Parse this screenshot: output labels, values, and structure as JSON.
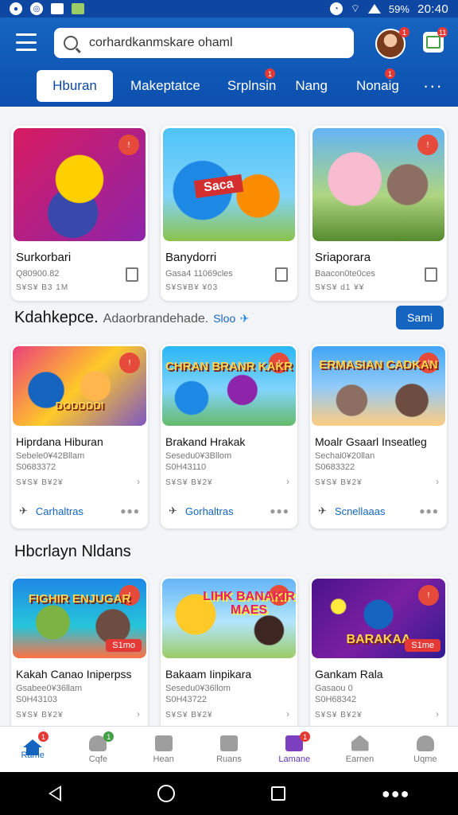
{
  "status_bar": {
    "time": "20:40",
    "battery": "59%"
  },
  "search": {
    "value": "corhardkanmskare ohaml"
  },
  "tabs": [
    {
      "label": "Hburan"
    },
    {
      "label": "Makeptatce"
    },
    {
      "label": "Srplnsin"
    },
    {
      "label": "Nang"
    },
    {
      "label": "Nonaig"
    }
  ],
  "tab_more": "···",
  "row1": [
    {
      "title": "Surkorbari",
      "sub1": "Q80900.82",
      "sub2": "S¥S¥ B3 1M"
    },
    {
      "title": "Banydorri",
      "sub1": "Gasa4 11069cles",
      "sub2": "S¥S¥B¥ ¥03"
    },
    {
      "title": "Sriaporara",
      "sub1": "Baacon0te0ces",
      "sub2": "S¥S¥ d1 ¥¥"
    }
  ],
  "section2": {
    "title": "Kdahkepce.",
    "subtitle": "Adaorbrandehade.",
    "link": "Sloo",
    "button": "Sami"
  },
  "row2": [
    {
      "title": "Hiprdana Hiburan",
      "sub1": "Sebele0¥42Bllam",
      "sub2": "S0683372",
      "sub3": "S¥S¥ B¥2¥",
      "action": "Carhaltras",
      "thumb_text": "DODDDDI"
    },
    {
      "title": "Brakand Hrakak",
      "sub1": "Sesedu0¥3Bllom",
      "sub2": "S0H43110",
      "sub3": "S¥S¥ B¥2¥",
      "action": "Gorhaltras",
      "thumb_text": "CHRAN BRANR KAKR"
    },
    {
      "title": "Moalr Gsaarl Inseatleg",
      "sub1": "Sechai0¥20llan",
      "sub2": "S0683322",
      "sub3": "S¥S¥ B¥2¥",
      "action": "Scnellaaas",
      "thumb_text": "ERMASIAN CADKAN"
    }
  ],
  "section3": {
    "title": "Hbcrlayn Nldans"
  },
  "row3": [
    {
      "title": "Kakah Canao Iniperpss",
      "sub1": "Gsabee0¥36llam",
      "sub2": "S0H43103",
      "sub3": "S¥S¥ B¥2¥",
      "price": "S1mo",
      "thumb_text": "FIGHIR ENJUGAR"
    },
    {
      "title": "Bakaam Iinpikara",
      "sub1": "Sesedu0¥36llom",
      "sub2": "S0H43722",
      "sub3": "S¥S¥ B¥2¥",
      "thumb_text": "LIHK BANAKIR MAES"
    },
    {
      "title": "Gankam Rala",
      "sub1": "Gasaou 0",
      "sub2": "S0H68342",
      "sub3": "S¥S¥ B¥2¥",
      "price": "S1me",
      "thumb_text": "BARAKAA"
    }
  ],
  "bottom_nav": [
    {
      "label": "Rame"
    },
    {
      "label": "Cqfe"
    },
    {
      "label": "Hean"
    },
    {
      "label": "Ruans"
    },
    {
      "label": "Lamane"
    },
    {
      "label": "Earnen"
    },
    {
      "label": "Uqme"
    }
  ],
  "badges": {
    "avatar": "1",
    "app": "11",
    "tab": "1",
    "nav_home": "1",
    "nav_cafe": "1",
    "nav_lamane": "1",
    "thumb": "!"
  }
}
